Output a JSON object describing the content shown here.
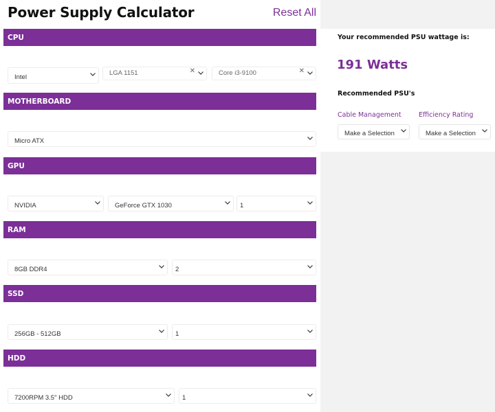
{
  "header": {
    "title": "Power Supply Calculator",
    "reset_label": "Reset All"
  },
  "sections": {
    "cpu": {
      "label": "CPU",
      "brand": "Intel",
      "socket": "LGA 1151",
      "model": "Core i3-9100"
    },
    "motherboard": {
      "label": "MOTHERBOARD",
      "form_factor": "Micro ATX"
    },
    "gpu": {
      "label": "GPU",
      "brand": "NVIDIA",
      "model": "GeForce GTX 1030",
      "count": "1"
    },
    "ram": {
      "label": "RAM",
      "type": "8GB DDR4",
      "count": "2"
    },
    "ssd": {
      "label": "SSD",
      "size": "256GB - 512GB",
      "count": "1"
    },
    "hdd": {
      "label": "HDD",
      "type": "7200RPM 3.5\" HDD",
      "count": "1"
    }
  },
  "result": {
    "label": "Your recommended PSU wattage is:",
    "watts": "191 Watts",
    "recommended_label": "Recommended PSU's",
    "filters": [
      {
        "label": "Cable Management",
        "value": "Make a Selection"
      },
      {
        "label": "Efficiency Rating",
        "value": "Make a Selection"
      }
    ]
  },
  "colors": {
    "accent": "#7b2f97",
    "panel_bg": "#f2f2f2"
  },
  "icons": {
    "chevron": "chevron-down-icon",
    "clear": "clear-icon"
  }
}
